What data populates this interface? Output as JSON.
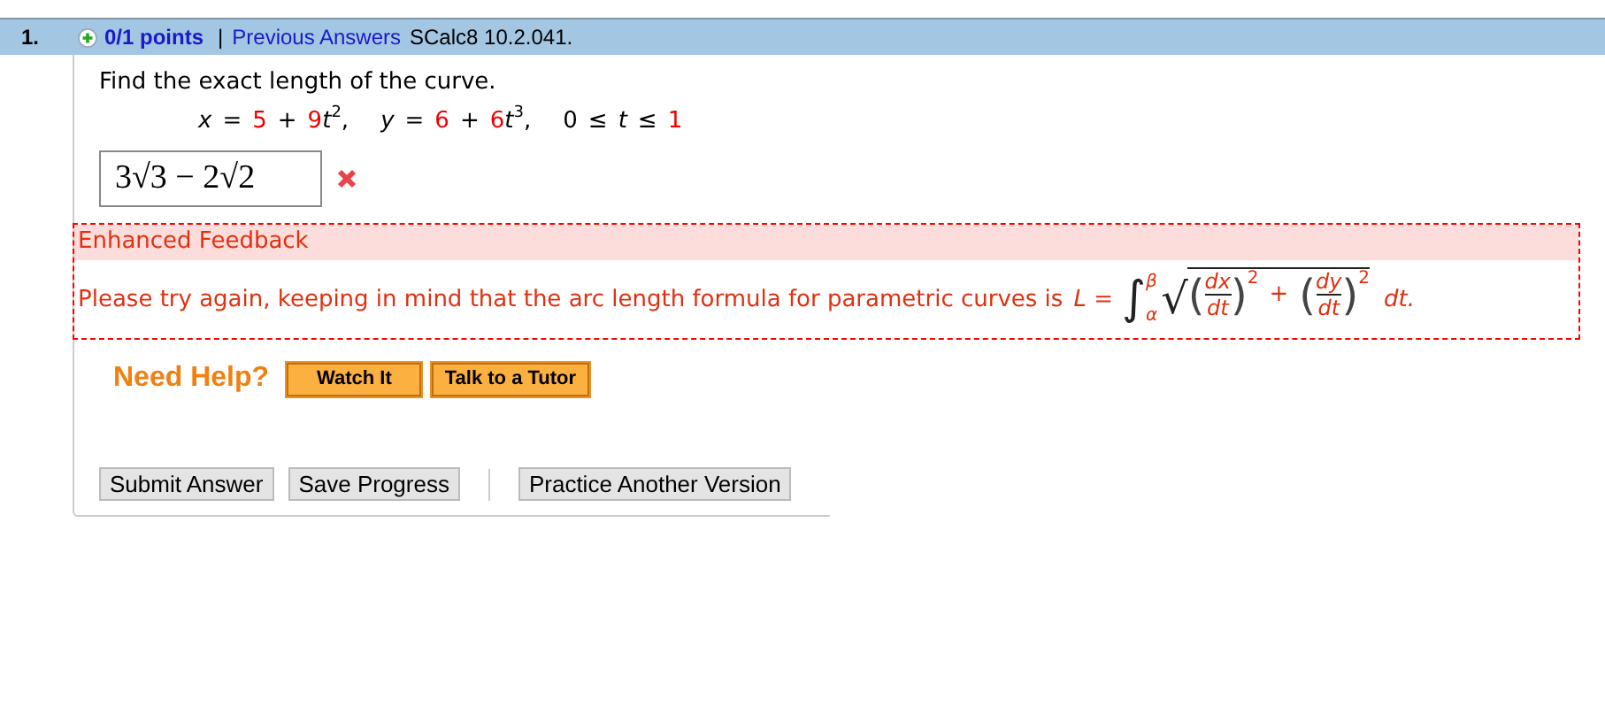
{
  "question": {
    "number": "1.",
    "points": "0/1 points",
    "separator": "|",
    "previous_answers": "Previous Answers",
    "reference": "SCalc8 10.2.041."
  },
  "prompt": "Find the exact length of the curve.",
  "equation": [
    {
      "text": "x",
      "kind": "var"
    },
    {
      "text": "=",
      "kind": "op"
    },
    {
      "text": "5",
      "kind": "num"
    },
    {
      "text": "+",
      "kind": "op"
    },
    {
      "text": "9",
      "kind": "num"
    },
    {
      "text": "t",
      "kind": "var"
    },
    {
      "text": "2",
      "kind": "sup"
    },
    {
      "text": ",",
      "kind": "gap"
    },
    {
      "text": "y",
      "kind": "var"
    },
    {
      "text": "=",
      "kind": "op"
    },
    {
      "text": "6",
      "kind": "num"
    },
    {
      "text": "+",
      "kind": "op"
    },
    {
      "text": "6",
      "kind": "num"
    },
    {
      "text": "t",
      "kind": "var"
    },
    {
      "text": "3",
      "kind": "sup"
    },
    {
      "text": ",",
      "kind": "gap"
    },
    {
      "text": "0",
      "kind": "plain"
    },
    {
      "text": "≤",
      "kind": "op"
    },
    {
      "text": "t",
      "kind": "var"
    },
    {
      "text": "≤",
      "kind": "op"
    },
    {
      "text": "1",
      "kind": "num"
    }
  ],
  "answer": {
    "value": "3√3 − 2√2",
    "correct": false
  },
  "feedback": {
    "title": "Enhanced Feedback",
    "message": "Please try again, keeping in mind that the arc length formula for parametric curves is",
    "formula": {
      "lhs": "L =",
      "integral": "∫",
      "upper": "β",
      "lower": "α",
      "root": "√",
      "open": "(",
      "close": ")",
      "num1": "dx",
      "den1": "dt",
      "exp1": "2",
      "plus": "+",
      "num2": "dy",
      "den2": "dt",
      "exp2": "2",
      "tail": "dt."
    }
  },
  "help": {
    "label": "Need Help?",
    "buttons": [
      "Watch It",
      "Talk to a Tutor"
    ]
  },
  "actions": [
    "Submit Answer",
    "Save Progress"
  ],
  "alt_action": "Practice Another Version"
}
